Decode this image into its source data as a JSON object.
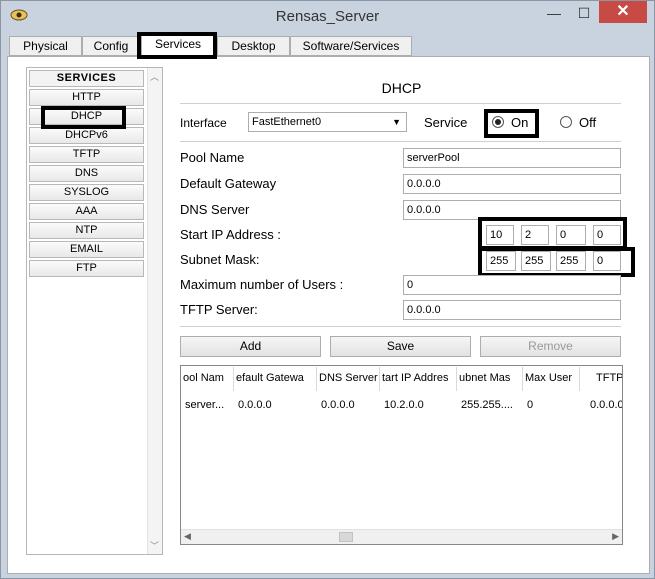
{
  "window": {
    "title": "Rensas_Server",
    "close_glyph": "✕",
    "minimize_glyph": "—",
    "maximize_glyph": "☐"
  },
  "tabs": [
    {
      "label": "Physical"
    },
    {
      "label": "Config"
    },
    {
      "label": "Services"
    },
    {
      "label": "Desktop"
    },
    {
      "label": "Software/Services"
    }
  ],
  "sidebar": {
    "header": "SERVICES",
    "items": [
      "HTTP",
      "DHCP",
      "DHCPv6",
      "TFTP",
      "DNS",
      "SYSLOG",
      "AAA",
      "NTP",
      "EMAIL",
      "FTP"
    ]
  },
  "dhcp": {
    "heading": "DHCP",
    "interface_label": "Interface",
    "interface_value": "FastEthernet0",
    "service_label": "Service",
    "on_label": "On",
    "off_label": "Off",
    "pool_name_label": "Pool Name",
    "pool_name_value": "serverPool",
    "gateway_label": "Default Gateway",
    "gateway_value": "0.0.0.0",
    "dns_label": "DNS Server",
    "dns_value": "0.0.0.0",
    "start_ip_label": "Start IP Address :",
    "start_ip": [
      "10",
      "2",
      "0",
      "0"
    ],
    "subnet_label": "Subnet Mask:",
    "subnet": [
      "255",
      "255",
      "255",
      "0"
    ],
    "max_users_label": "Maximum number of Users :",
    "max_users_value": "0",
    "tftp_label": "TFTP Server:",
    "tftp_value": "0.0.0.0",
    "add_label": "Add",
    "save_label": "Save",
    "remove_label": "Remove"
  },
  "pool_table": {
    "headers": [
      "ool Nam",
      "efault Gatewa",
      "DNS Server",
      "tart IP Addres",
      "ubnet Mas",
      "Max User",
      "TFTP"
    ],
    "rows": [
      [
        "server...",
        "0.0.0.0",
        "0.0.0.0",
        "10.2.0.0",
        "255.255....",
        "0",
        "0.0.0.0"
      ]
    ]
  }
}
